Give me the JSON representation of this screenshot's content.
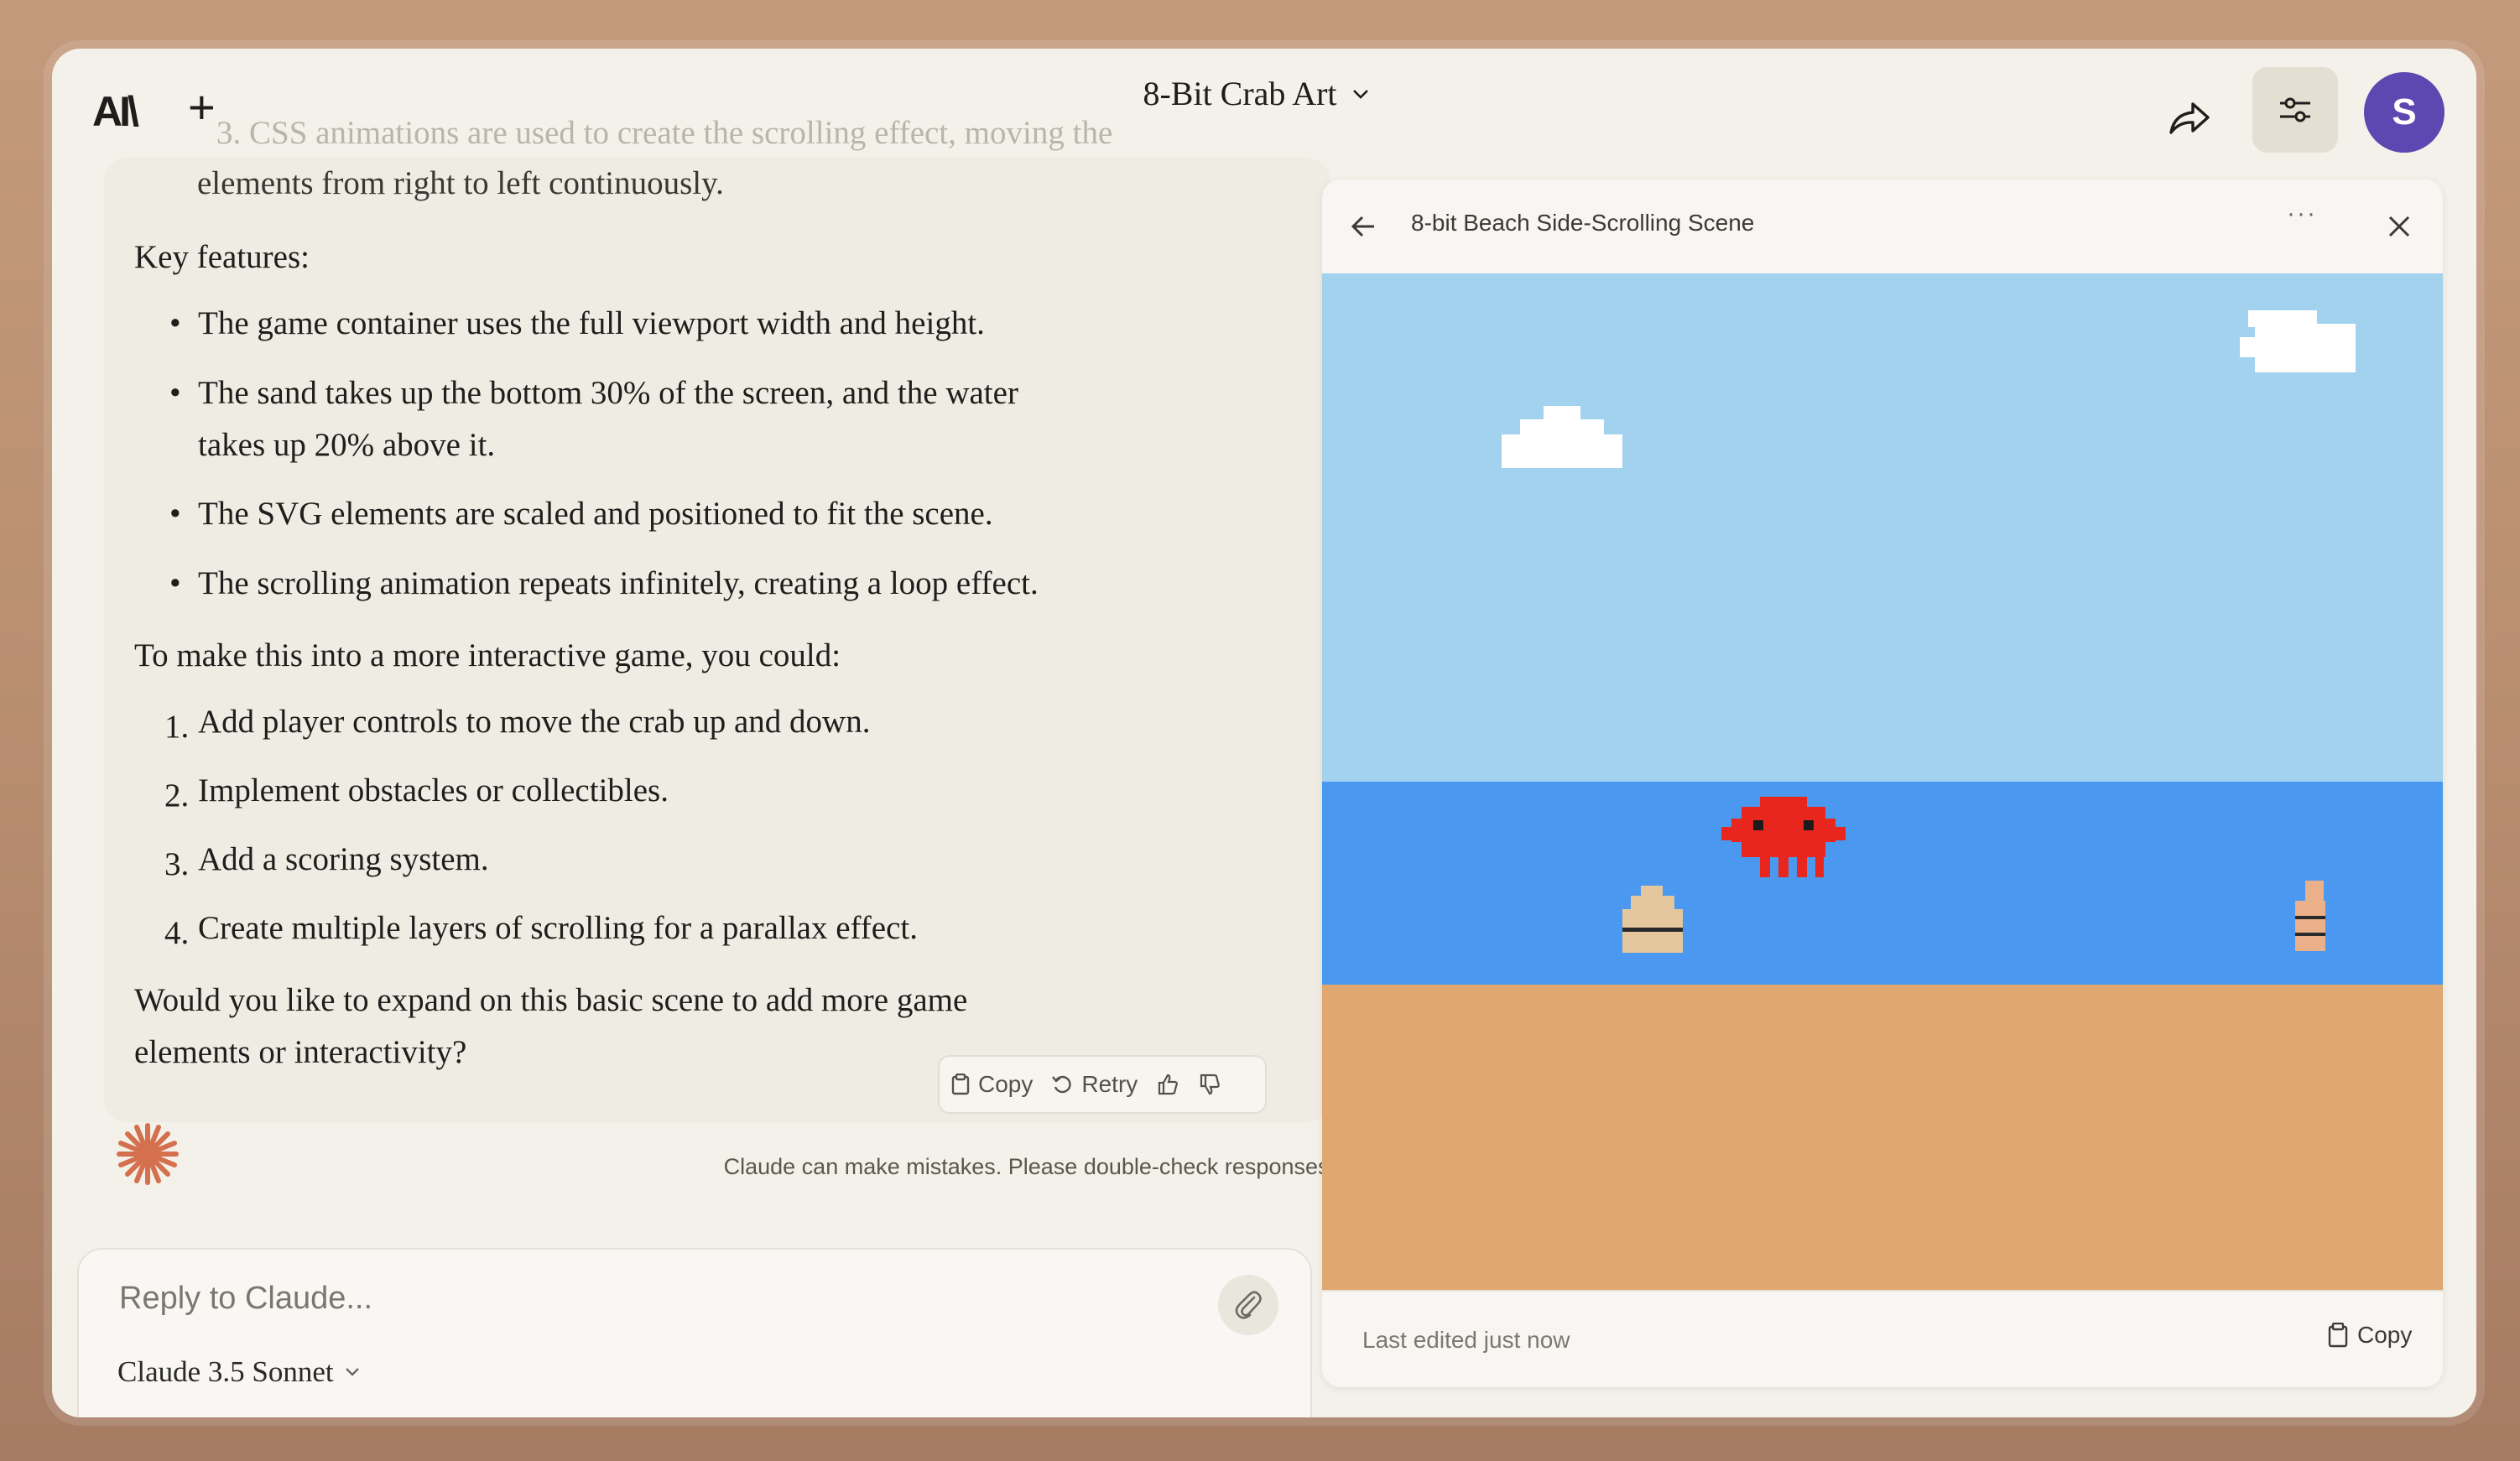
{
  "app": {
    "logo": "AI\\",
    "new_chat": "+",
    "title": "8-Bit Crab Art",
    "avatar_initial": "S"
  },
  "chat": {
    "faded_line_1": "3. CSS animations are used to create the scrolling effect, moving the",
    "faded_line_2": "elements from right to left continuously.",
    "key_features_heading": "Key features:",
    "features": [
      "The game container uses the full viewport width and height.",
      "The sand takes up the bottom 30% of the screen, and the water",
      "takes up 20% above it.",
      "The SVG elements are scaled and positioned to fit the scene.",
      "The scrolling animation repeats infinitely, creating a loop effect."
    ],
    "interactive_intro": "To make this into a more interactive game, you could:",
    "steps": [
      {
        "n": "1.",
        "text": "Add player controls to move the crab up and down."
      },
      {
        "n": "2.",
        "text": "Implement obstacles or collectibles."
      },
      {
        "n": "3.",
        "text": "Add a scoring system."
      },
      {
        "n": "4.",
        "text": "Create multiple layers of scrolling for a parallax effect."
      }
    ],
    "closing_line_1": "Would you like to expand on this basic scene to add more game",
    "closing_line_2": "elements or interactivity?",
    "actions": {
      "copy": "Copy",
      "retry": "Retry"
    },
    "disclaimer": "Claude can make mistakes. Please double-check responses."
  },
  "composer": {
    "placeholder": "Reply to Claude...",
    "model": "Claude 3.5 Sonnet"
  },
  "artifact": {
    "title": "8-bit Beach Side-Scrolling Scene",
    "more": "···",
    "last_edited": "Last edited just now",
    "copy_label": "Copy"
  },
  "colors": {
    "sky": "#a2d2ee",
    "water": "#4a98f0",
    "sand": "#e0a870",
    "crab": "#e8261d",
    "cloud": "#ffffff",
    "avatar": "#5c48b0",
    "claude_mark": "#d4704d"
  }
}
